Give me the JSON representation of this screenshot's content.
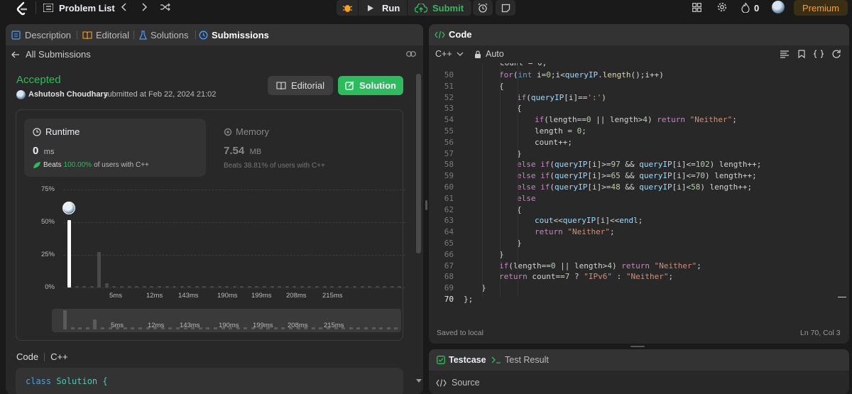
{
  "nav": {
    "problem_list": "Problem List",
    "run": "Run",
    "submit": "Submit",
    "streak": "0",
    "premium": "Premium"
  },
  "left_tabs": {
    "description": "Description",
    "editorial": "Editorial",
    "solutions": "Solutions",
    "submissions": "Submissions"
  },
  "submission": {
    "back": "All Submissions",
    "status": "Accepted",
    "user": "Ashutosh Choudhary",
    "submitted": "submitted at Feb 22, 2024 21:02",
    "editorial_btn": "Editorial",
    "solution_btn": "Solution",
    "runtime_label": "Runtime",
    "runtime_value": "0",
    "runtime_unit": "ms",
    "runtime_beats_prefix": "Beats",
    "runtime_beats_pct": "100.00%",
    "runtime_beats_suffix": "of users with C++",
    "memory_label": "Memory",
    "memory_value": "7.54",
    "memory_unit": "MB",
    "memory_beats": "Beats 38.81% of users with C++",
    "code_label": "Code",
    "code_lang": "C++",
    "code_first_line_kw": "class",
    "code_first_line_rest": "Solution {"
  },
  "chart_data": {
    "type": "bar",
    "ylabel": "",
    "xlabel": "",
    "yticks": [
      "75%",
      "50%",
      "25%",
      "0%"
    ],
    "ylim": [
      0,
      75
    ],
    "xticks": [
      "5ms",
      "12ms",
      "143ms",
      "190ms",
      "199ms",
      "208ms",
      "215ms"
    ],
    "values": [
      51.5,
      0.5,
      0.5,
      0.5,
      27,
      3.5,
      0.5,
      0.5,
      0.5,
      0.5,
      0.5,
      0.5,
      0.5,
      0.5,
      0.5,
      0.5,
      0.5,
      0.5,
      0.5,
      0.5,
      0.5,
      0.5,
      0.5,
      0.5,
      0.5,
      0.5,
      0.5,
      0.5,
      0.5,
      0.5,
      0.5,
      0.5,
      0.5,
      0.5,
      0.5,
      0.5,
      0.5,
      0.5,
      0.5,
      0.5,
      0.5,
      0.5,
      0.5,
      0.5,
      0.5
    ],
    "highlight_index": 0,
    "highlight_color": "#ffffff",
    "bar_color": "#4a4a4a"
  },
  "code_panel": {
    "title": "Code",
    "lang": "C++",
    "auto": "Auto",
    "saved": "Saved to local",
    "cursor": "Ln 70, Col 3"
  },
  "code_lines": [
    {
      "n": "50",
      "ind": 2,
      "html": "<span class='kw'>for</span>(<span class='ty'>int</span> i=<span class='num'>0</span>;i<<span class='var'>queryIP</span>.<span class='fn'>length</span>();i++)"
    },
    {
      "n": "51",
      "ind": 2,
      "html": "{"
    },
    {
      "n": "52",
      "ind": 3,
      "html": "<span class='kw'>if</span>(<span class='var'>queryIP</span>[i]==<span class='str'>':'</span>)"
    },
    {
      "n": "53",
      "ind": 3,
      "html": "{"
    },
    {
      "n": "54",
      "ind": 4,
      "html": "<span class='kw'>if</span>(length==<span class='num'>0</span> || length><span class='num'>4</span>) <span class='kw'>return</span> <span class='str'>\"Neither\"</span>;"
    },
    {
      "n": "55",
      "ind": 4,
      "html": "length = <span class='num'>0</span>;"
    },
    {
      "n": "56",
      "ind": 4,
      "html": "count++;"
    },
    {
      "n": "57",
      "ind": 3,
      "html": "}"
    },
    {
      "n": "58",
      "ind": 3,
      "html": "<span class='kw'>else if</span>(<span class='var'>queryIP</span>[i]>=<span class='num'>97</span> && <span class='var'>queryIP</span>[i]<=<span class='num'>102</span>) length++;"
    },
    {
      "n": "59",
      "ind": 3,
      "html": "<span class='kw'>else if</span>(<span class='var'>queryIP</span>[i]>=<span class='num'>65</span> && <span class='var'>queryIP</span>[i]<=<span class='num'>70</span>) length++;"
    },
    {
      "n": "60",
      "ind": 3,
      "html": "<span class='kw'>else if</span>(<span class='var'>queryIP</span>[i]>=<span class='num'>48</span> && <span class='var'>queryIP</span>[i]<<span class='num'>58</span>) length++;"
    },
    {
      "n": "61",
      "ind": 3,
      "html": "<span class='kw'>else</span>"
    },
    {
      "n": "62",
      "ind": 3,
      "html": "{"
    },
    {
      "n": "63",
      "ind": 4,
      "html": "<span class='var'>cout</span><<<span class='var'>queryIP</span>[i]<<<span class='var'>endl</span>;"
    },
    {
      "n": "64",
      "ind": 4,
      "html": "<span class='kw'>return</span> <span class='str'>\"Neither\"</span>;"
    },
    {
      "n": "65",
      "ind": 3,
      "html": "}"
    },
    {
      "n": "66",
      "ind": 2,
      "html": "}"
    },
    {
      "n": "67",
      "ind": 2,
      "html": "<span class='kw'>if</span>(length==<span class='num'>0</span> || length><span class='num'>4</span>) <span class='kw'>return</span> <span class='str'>\"Neither\"</span>;"
    },
    {
      "n": "68",
      "ind": 2,
      "html": "<span class='kw'>return</span> count==<span class='num'>7</span> ? <span class='str'>\"IPv6\"</span> : <span class='str'>\"Neither\"</span>;"
    },
    {
      "n": "69",
      "ind": 1,
      "html": "}"
    },
    {
      "n": "70",
      "ind": 0,
      "html": "};"
    }
  ],
  "bottom": {
    "testcase": "Testcase",
    "test_result": "Test Result",
    "source": "Source"
  }
}
